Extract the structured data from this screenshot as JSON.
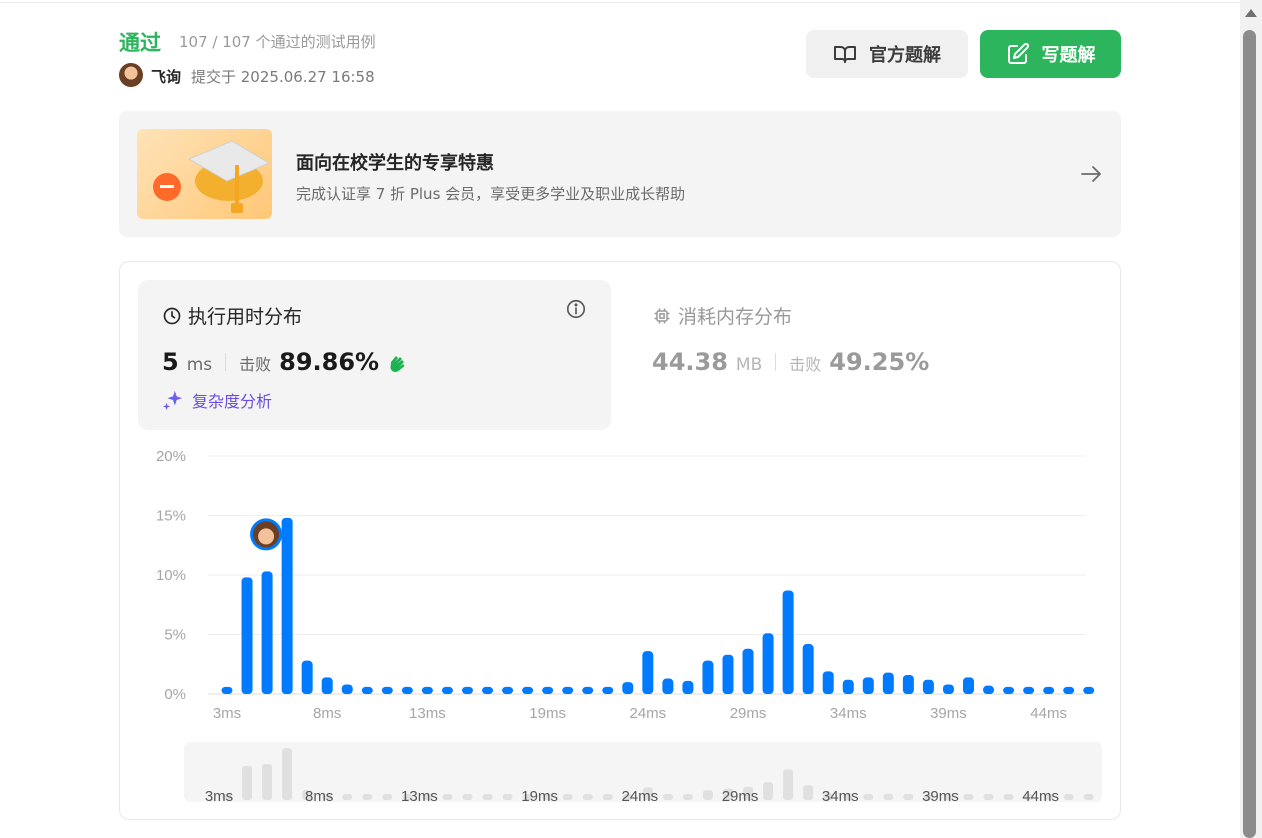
{
  "header": {
    "status": "通过",
    "cases": "107 / 107 个通过的测试用例",
    "username": "飞询",
    "submitted": "提交于 2025.06.27 16:58",
    "official_solution": "官方题解",
    "write_solution": "写题解"
  },
  "promo": {
    "title": "面向在校学生的专享特惠",
    "subtitle": "完成认证享 7 折 Plus 会员，享受更多学业及职业成长帮助"
  },
  "runtime": {
    "title": "执行用时分布",
    "value": "5",
    "unit": "ms",
    "beat_label": "击败",
    "beat_value": "89.86%",
    "complexity_link": "复杂度分析"
  },
  "memory": {
    "title": "消耗内存分布",
    "value": "44.38",
    "unit": "MB",
    "beat_label": "击败",
    "beat_value": "49.25%"
  },
  "colors": {
    "accent_green": "#2db55d",
    "bar_blue": "#007aff",
    "complexity_purple": "#6b4ce0"
  },
  "chart_data": {
    "type": "bar",
    "x_unit": "ms",
    "x": [
      3,
      4,
      5,
      6,
      7,
      8,
      9,
      10,
      11,
      12,
      13,
      14,
      15,
      16,
      17,
      18,
      19,
      20,
      21,
      22,
      23,
      24,
      25,
      26,
      27,
      28,
      29,
      30,
      31,
      32,
      33,
      34,
      35,
      36,
      37,
      38,
      39,
      40,
      41,
      42,
      43,
      44,
      45,
      46
    ],
    "values": [
      0.6,
      9.8,
      10.3,
      14.8,
      2.8,
      1.4,
      0.8,
      0.6,
      0.6,
      0.6,
      0.6,
      0.6,
      0.6,
      0.6,
      0.6,
      0.6,
      0.6,
      0.6,
      0.6,
      0.6,
      1.0,
      3.6,
      1.3,
      1.1,
      2.8,
      3.3,
      3.8,
      5.1,
      8.7,
      4.2,
      1.9,
      1.2,
      1.4,
      1.8,
      1.6,
      1.2,
      0.8,
      1.4,
      0.7,
      0.6,
      0.6,
      0.6,
      0.6,
      0.6
    ],
    "yticks": [
      "0%",
      "5%",
      "10%",
      "15%",
      "20%"
    ],
    "xticks": [
      "3ms",
      "8ms",
      "13ms",
      "19ms",
      "24ms",
      "29ms",
      "34ms",
      "39ms",
      "44ms"
    ],
    "ylim": [
      0,
      20
    ],
    "grid": true,
    "highlight_x": 5,
    "overview_xticks": [
      "3ms",
      "8ms",
      "13ms",
      "19ms",
      "24ms",
      "29ms",
      "34ms",
      "39ms",
      "44ms"
    ]
  }
}
